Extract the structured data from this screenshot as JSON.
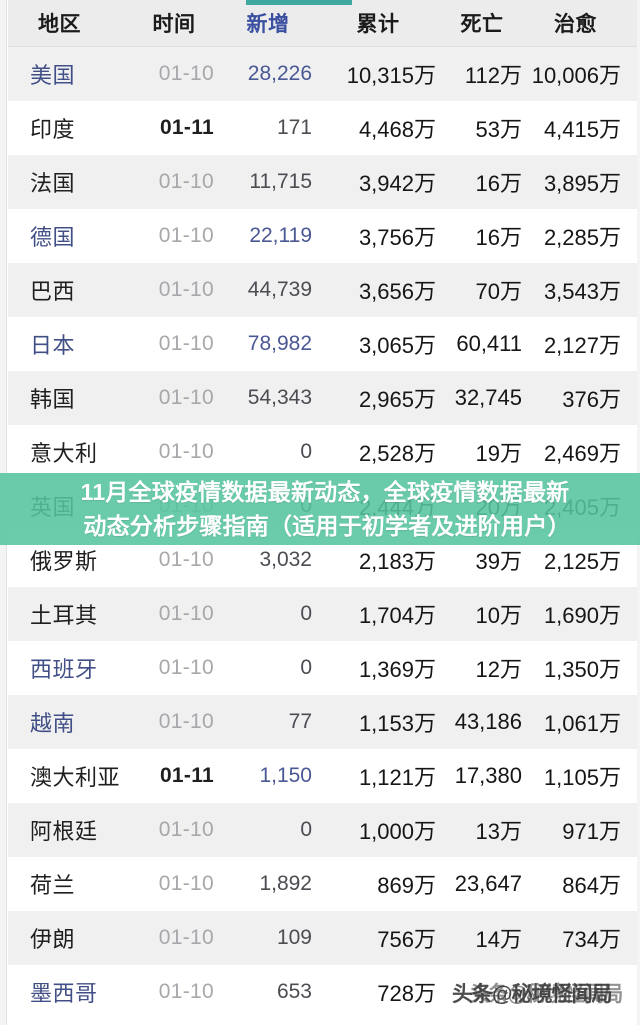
{
  "table": {
    "headers": {
      "region": "地区",
      "date": "时间",
      "new": "新增",
      "total": "累计",
      "death": "死亡",
      "cure": "治愈"
    },
    "active_column": "新增",
    "accent_color": "#3fa9a0",
    "active_header_color": "#3b4fa0",
    "rows": [
      {
        "region": "美国",
        "date": "01-10",
        "new": "28,226",
        "total": "10,315万",
        "death": "112万",
        "cure": "10,006万"
      },
      {
        "region": "印度",
        "date": "01-11",
        "new": "171",
        "total": "4,468万",
        "death": "53万",
        "cure": "4,415万"
      },
      {
        "region": "法国",
        "date": "01-10",
        "new": "11,715",
        "total": "3,942万",
        "death": "16万",
        "cure": "3,895万"
      },
      {
        "region": "德国",
        "date": "01-10",
        "new": "22,119",
        "total": "3,756万",
        "death": "16万",
        "cure": "2,285万"
      },
      {
        "region": "巴西",
        "date": "01-10",
        "new": "44,739",
        "total": "3,656万",
        "death": "70万",
        "cure": "3,543万"
      },
      {
        "region": "日本",
        "date": "01-10",
        "new": "78,982",
        "total": "3,065万",
        "death": "60,411",
        "cure": "2,127万"
      },
      {
        "region": "韩国",
        "date": "01-10",
        "new": "54,343",
        "total": "2,965万",
        "death": "32,745",
        "cure": "376万"
      },
      {
        "region": "意大利",
        "date": "01-10",
        "new": "0",
        "total": "2,528万",
        "death": "19万",
        "cure": "2,469万"
      },
      {
        "region": "英国",
        "date": "01-10",
        "new": "0",
        "total": "2,444万",
        "death": "20万",
        "cure": "2,405万"
      },
      {
        "region": "俄罗斯",
        "date": "01-10",
        "new": "3,032",
        "total": "2,183万",
        "death": "39万",
        "cure": "2,125万"
      },
      {
        "region": "土耳其",
        "date": "01-10",
        "new": "0",
        "total": "1,704万",
        "death": "10万",
        "cure": "1,690万"
      },
      {
        "region": "西班牙",
        "date": "01-10",
        "new": "0",
        "total": "1,369万",
        "death": "12万",
        "cure": "1,350万"
      },
      {
        "region": "越南",
        "date": "01-10",
        "new": "77",
        "total": "1,153万",
        "death": "43,186",
        "cure": "1,061万"
      },
      {
        "region": "澳大利亚",
        "date": "01-11",
        "new": "1,150",
        "total": "1,121万",
        "death": "17,380",
        "cure": "1,105万"
      },
      {
        "region": "阿根廷",
        "date": "01-10",
        "new": "0",
        "total": "1,000万",
        "death": "13万",
        "cure": "971万"
      },
      {
        "region": "荷兰",
        "date": "01-10",
        "new": "1,892",
        "total": "869万",
        "death": "23,647",
        "cure": "864万"
      },
      {
        "region": "伊朗",
        "date": "01-10",
        "new": "109",
        "total": "756万",
        "death": "14万",
        "cure": "734万"
      },
      {
        "region": "墨西哥",
        "date": "01-10",
        "new": "653",
        "total": "728万",
        "death": "",
        "cure": ""
      }
    ]
  },
  "banner": {
    "line1": "11月全球疫情数据最新动态，全球疫情数据最新",
    "line2": "动态分析步骤指南（适用于初学者及进阶用户）",
    "background_color": "#56c5a1",
    "text_color": "#ffffff"
  },
  "watermark": {
    "text": "头条@秘境怪闻局",
    "text_overlap": "头条@秘境怪闻局"
  }
}
